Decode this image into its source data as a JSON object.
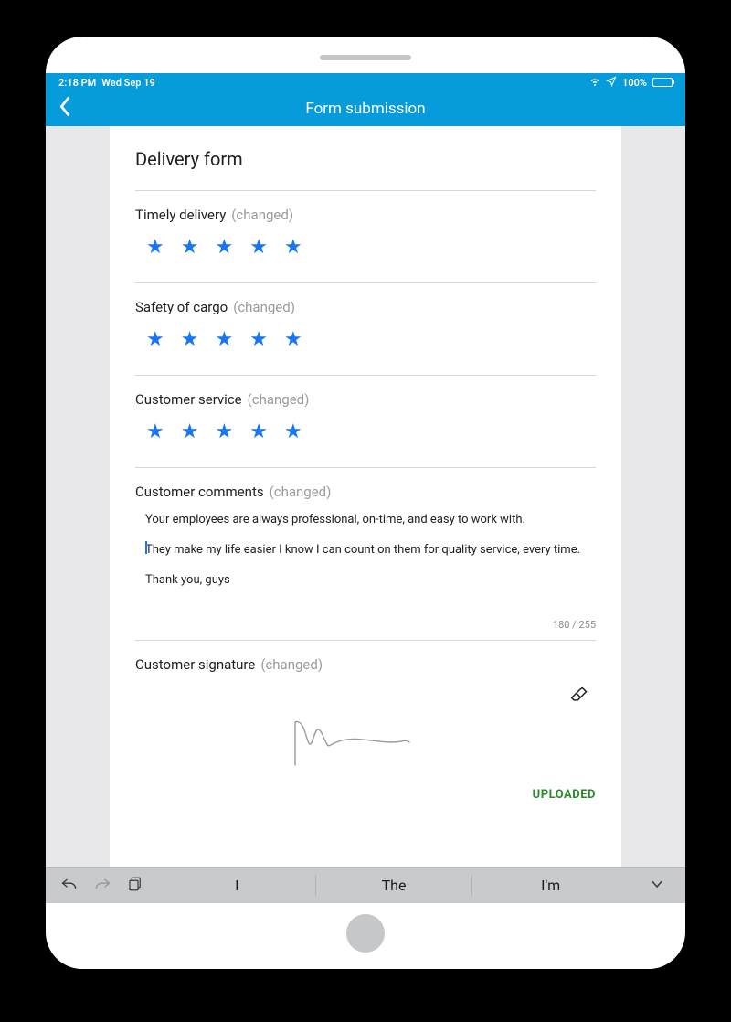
{
  "status_bar": {
    "time": "2:18 PM",
    "date": "Wed Sep 19",
    "battery_pct": "100%"
  },
  "header": {
    "title": "Form submission"
  },
  "form": {
    "title": "Delivery form",
    "changed_label": "(changed)",
    "sections": {
      "timely": {
        "label": "Timely delivery",
        "stars": 5
      },
      "safety": {
        "label": "Safety of cargo",
        "stars": 5
      },
      "service": {
        "label": "Customer service",
        "stars": 5
      },
      "comments": {
        "label": "Customer comments",
        "line1": "Your employees are always professional, on-time, and easy to work with.",
        "line2": "They make my life easier I know I can count on them for quality service, every time.",
        "line3": "Thank you, guys",
        "char_count": "180 / 255"
      },
      "signature": {
        "label": "Customer signature",
        "status": "UPLOADED"
      }
    }
  },
  "keyboard": {
    "suggestion1": "I",
    "suggestion2": "The",
    "suggestion3": "I'm"
  }
}
